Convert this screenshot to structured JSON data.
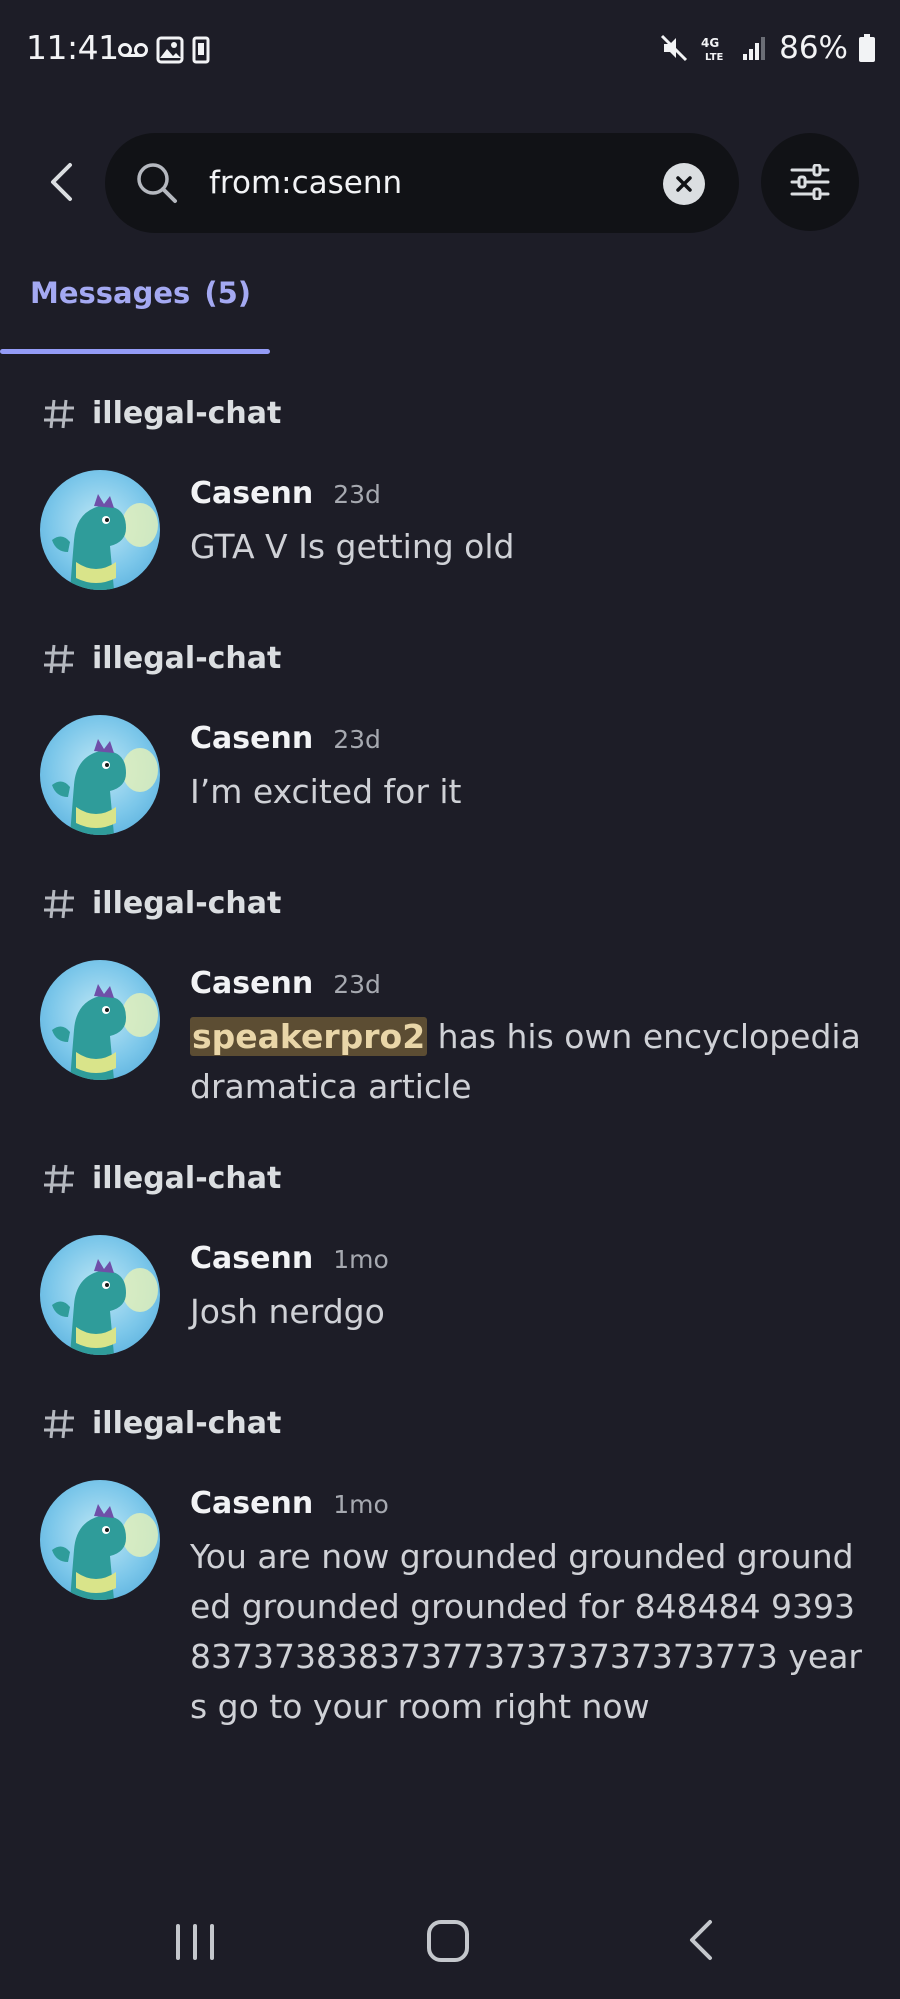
{
  "status_bar": {
    "time": "11:41",
    "battery": "86%"
  },
  "search": {
    "query": "from:casenn"
  },
  "tabs": {
    "messages_label": "Messages",
    "messages_count": "(5)"
  },
  "results": [
    {
      "channel": "illegal-chat",
      "author": "Casenn",
      "time": "23d",
      "text": "GTA V Is getting old"
    },
    {
      "channel": "illegal-chat",
      "author": "Casenn",
      "time": "23d",
      "text": "I’m excited for it"
    },
    {
      "channel": "illegal-chat",
      "author": "Casenn",
      "time": "23d",
      "mention": "speakerpro2",
      "text": " has his own encyclopedia dramatica article"
    },
    {
      "channel": "illegal-chat",
      "author": "Casenn",
      "time": "1mo",
      "text": "Josh nerdgo"
    },
    {
      "channel": "illegal-chat",
      "author": "Casenn",
      "time": "1mo",
      "text": "You are now grounded grounded grounded grounded grounded for 848484 93938373738383737737373737373773 years go to your room right now"
    }
  ],
  "colors": {
    "background": "#1d1d27",
    "accent": "#949cf7",
    "mention_bg": "#5c4d33"
  }
}
